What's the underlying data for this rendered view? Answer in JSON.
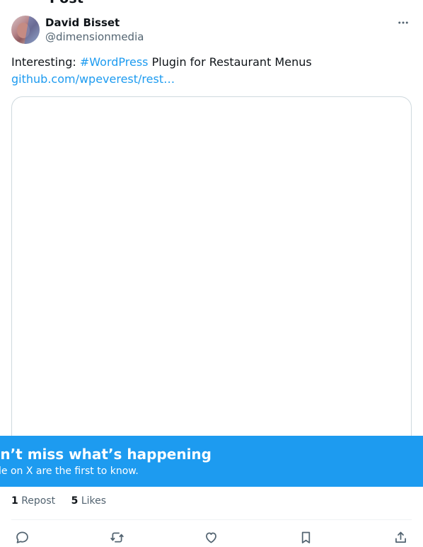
{
  "header": {
    "cut_title": "Post"
  },
  "author": {
    "name": "David Bisset",
    "handle": "@dimensionmedia",
    "avatar_icon": "user-avatar"
  },
  "tweet": {
    "text_prefix": "Interesting: ",
    "hashtag": "#WordPress",
    "text_suffix": " Plugin for Restaurant Menus",
    "link": "github.com/wpeverest/rest…"
  },
  "banner": {
    "title": "Don’t miss what’s happening",
    "subtitle": "People on X are the first to know."
  },
  "stats": {
    "reposts_count": "1",
    "reposts_label": "Repost",
    "likes_count": "5",
    "likes_label": "Likes"
  },
  "actions": {
    "reply_icon": "reply-icon",
    "repost_icon": "repost-icon",
    "like_icon": "like-icon",
    "bookmark_icon": "bookmark-icon",
    "share_icon": "share-icon"
  },
  "colors": {
    "accent": "#1d9bf0",
    "text": "#0f1419",
    "muted": "#536471",
    "border": "#cfd9de"
  }
}
